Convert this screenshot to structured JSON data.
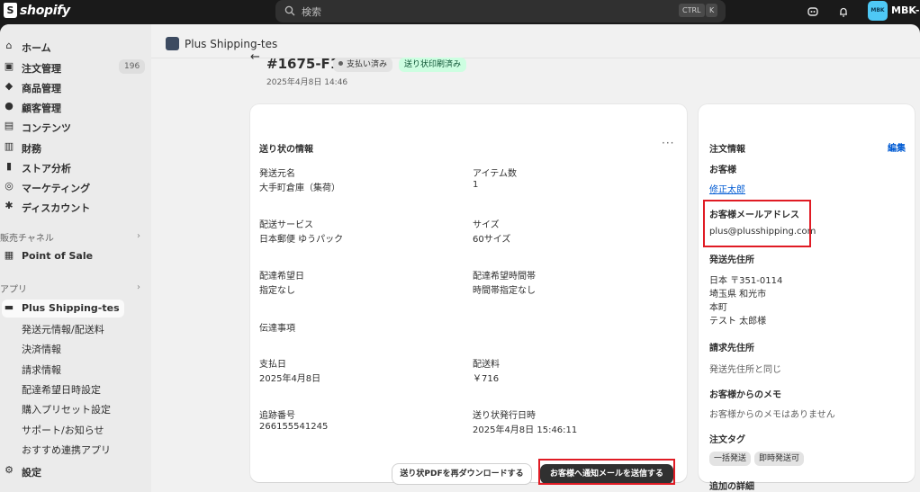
{
  "topbar": {
    "brand": "shopify",
    "search_placeholder": "検索",
    "shortcut_ctrl": "CTRL",
    "shortcut_k": "K",
    "avatar_initials": "MBK",
    "store_name": "MBK-Di"
  },
  "sidebar": {
    "items": [
      {
        "label": "ホーム",
        "icon": "home-icon"
      },
      {
        "label": "注文管理",
        "icon": "orders-icon",
        "badge": "196"
      },
      {
        "label": "商品管理",
        "icon": "tag-icon"
      },
      {
        "label": "顧客管理",
        "icon": "person-icon"
      },
      {
        "label": "コンテンツ",
        "icon": "content-icon"
      },
      {
        "label": "財務",
        "icon": "bank-icon"
      },
      {
        "label": "ストア分析",
        "icon": "chart-icon"
      },
      {
        "label": "マーケティング",
        "icon": "target-icon"
      },
      {
        "label": "ディスカウント",
        "icon": "discount-icon"
      }
    ],
    "sales_channels_label": "販売チャネル",
    "point_of_sale": "Point of Sale",
    "apps_label": "アプリ",
    "app_name": "Plus Shipping-tes",
    "app_subitems": [
      "発送元情報/配送料",
      "決済情報",
      "請求情報",
      "配達希望日時設定",
      "購入プリセット設定",
      "サポート/お知らせ",
      "おすすめ連携アプリ"
    ],
    "settings": "設定"
  },
  "app_header": {
    "title": "Plus Shipping-tes"
  },
  "order": {
    "number": "#1675-F1",
    "badge_paid": "支払い済み",
    "badge_printed": "送り状印刷済み",
    "date": "2025年4月8日 14:46"
  },
  "shipping_card": {
    "title": "送り状の情報",
    "more": "···",
    "fields": {
      "sender_label": "発送元名",
      "sender_value": "大手町倉庫（集荷）",
      "items_label": "アイテム数",
      "items_value": "1",
      "service_label": "配送サービス",
      "service_value": "日本郵便 ゆうパック",
      "size_label": "サイズ",
      "size_value": "60サイズ",
      "date_label": "配達希望日",
      "date_value": "指定なし",
      "time_label": "配達希望時間帯",
      "time_value": "時間帯指定なし",
      "message_label": "伝達事項",
      "pay_date_label": "支払日",
      "pay_date_value": "2025年4月8日",
      "fee_label": "配送料",
      "fee_value": "￥716",
      "tracking_label": "追跡番号",
      "tracking_value": "266155541245",
      "issued_label": "送り状発行日時",
      "issued_value": "2025年4月8日 15:46:11"
    },
    "redownload_button": "送り状PDFを再ダウンロードする",
    "notify_button": "お客様へ通知メールを送信する"
  },
  "order_info": {
    "title": "注文情報",
    "edit": "編集",
    "customer_label": "お客様",
    "customer_name": "修正太郎",
    "email_label": "お客様メールアドレス",
    "email": "plus@plusshipping.com",
    "shipping_address_label": "発送先住所",
    "address_lines": [
      "日本 〒351-0114",
      "埼玉県 和光市",
      "本町",
      "テスト 太郎様"
    ],
    "billing_label": "請求先住所",
    "billing_value": "発送先住所と同じ",
    "memo_label": "お客様からのメモ",
    "memo_value": "お客様からのメモはありません",
    "tags_label": "注文タグ",
    "tags": [
      "一括発送",
      "即時発送可"
    ],
    "extra_label": "追加の詳細"
  },
  "colors": {
    "accent": "#303030",
    "link": "#005bd3",
    "highlight": "#e01b24",
    "badge_success": "#cdfee1"
  }
}
